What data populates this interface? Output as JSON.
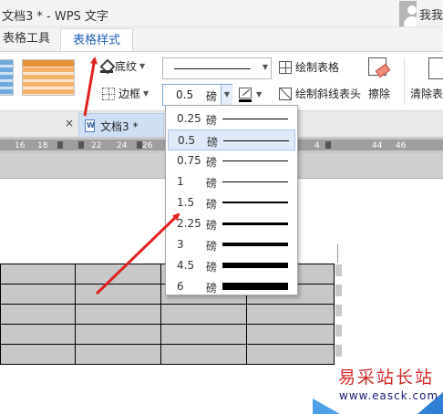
{
  "window": {
    "title": "文档3 * - WPS 文字",
    "user": "我我"
  },
  "ribbon_tabs": [
    {
      "label": "表格工具"
    },
    {
      "label": "表格样式"
    }
  ],
  "ribbon": {
    "shading_label": "底纹",
    "borders_label": "边框",
    "line_weight": {
      "value": "0.5",
      "unit": "磅"
    },
    "draw_table_label": "绘制表格",
    "draw_diagonal_label": "绘制斜线表头",
    "erase_label": "擦除",
    "clear_label": "清除表"
  },
  "document_tab": {
    "close": "×",
    "label": "文档3 *"
  },
  "ruler_ticks": [
    "16",
    "18",
    "22",
    "24",
    "26",
    "4",
    "44",
    "46"
  ],
  "line_weight_menu": {
    "unit": "磅",
    "selected": "0.5",
    "options": [
      {
        "label": "0.25",
        "weight_pt": 0.25
      },
      {
        "label": "0.5",
        "weight_pt": 0.5
      },
      {
        "label": "0.75",
        "weight_pt": 0.75
      },
      {
        "label": "1",
        "weight_pt": 1
      },
      {
        "label": "1.5",
        "weight_pt": 1.5
      },
      {
        "label": "2.25",
        "weight_pt": 2.25
      },
      {
        "label": "3",
        "weight_pt": 3
      },
      {
        "label": "4.5",
        "weight_pt": 4.5
      },
      {
        "label": "6",
        "weight_pt": 6
      }
    ]
  },
  "colors": {
    "accent": "#1e5fb4",
    "annotation_arrow": "#e02020",
    "table_fill": "#c8c8c8",
    "selection": "#dfe9f8"
  },
  "watermark": {
    "text": "易采站长站",
    "url": "www.easck.com"
  }
}
